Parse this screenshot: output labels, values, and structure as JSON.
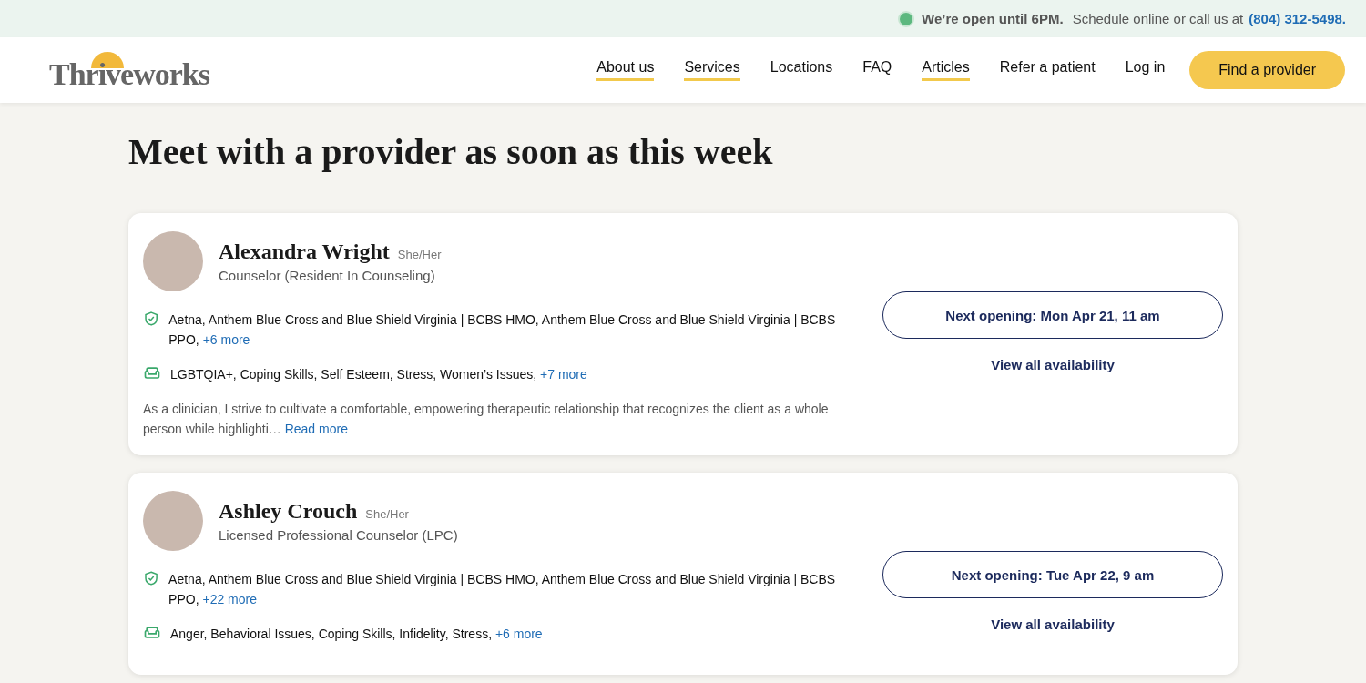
{
  "top_bar": {
    "open_text": "We’re open until 6PM.",
    "contact_text": "Schedule online or call us at",
    "phone": "(804) 312-5498."
  },
  "header": {
    "logo": "Thriveworks",
    "nav": [
      {
        "label": "About us",
        "underlined": true
      },
      {
        "label": "Services",
        "underlined": true
      },
      {
        "label": "Locations",
        "underlined": false
      },
      {
        "label": "FAQ",
        "underlined": false
      },
      {
        "label": "Articles",
        "underlined": true
      },
      {
        "label": "Refer a patient",
        "underlined": false
      },
      {
        "label": "Log in",
        "underlined": false
      }
    ],
    "cta": "Find a provider"
  },
  "heading": "Meet with a provider as soon as this week",
  "providers": [
    {
      "name": "Alexandra Wright",
      "pronouns": "She/Her",
      "title": "Counselor (Resident In Counseling)",
      "insurance": "Aetna, Anthem Blue Cross and Blue Shield Virginia | BCBS HMO, Anthem Blue Cross and Blue Shield Virginia | BCBS PPO,",
      "insurance_more": "+6 more",
      "specialties": "LGBTQIA+, Coping Skills, Self Esteem, Stress, Women’s Issues,",
      "specialties_more": "+7 more",
      "bio": "As a clinician, I strive to cultivate a comfortable, empowering therapeutic relationship that recognizes the client as a whole person while highlighti…",
      "bio_more": "Read more",
      "next_opening": "Next opening: Mon Apr 21, 11 am",
      "availability": "View all availability"
    },
    {
      "name": "Ashley Crouch",
      "pronouns": "She/Her",
      "title": "Licensed Professional Counselor (LPC)",
      "insurance": "Aetna, Anthem Blue Cross and Blue Shield Virginia | BCBS HMO, Anthem Blue Cross and Blue Shield Virginia | BCBS PPO,",
      "insurance_more": "+22 more",
      "specialties": "Anger, Behavioral Issues, Coping Skills, Infidelity, Stress,",
      "specialties_more": "+6 more",
      "next_opening": "Next opening: Tue Apr 22, 9 am",
      "availability": "View all availability"
    }
  ]
}
